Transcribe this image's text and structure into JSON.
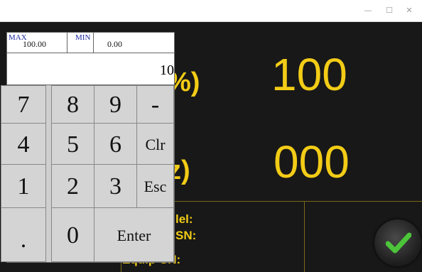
{
  "window": {
    "controls": {
      "minimize": "—",
      "maximize": "☐",
      "close": "✕"
    }
  },
  "display": {
    "unit1": "%)",
    "value1": "100",
    "unit2": "z)",
    "value2": "000"
  },
  "info": {
    "label1": "lel:",
    "label2": "SN:",
    "label3": "Equip-SN:"
  },
  "keypad": {
    "max_label": "MAX",
    "max_value": "100.00",
    "min_label": "MIN",
    "min_value": "0.00",
    "entry_value": "10",
    "keys": {
      "k7": "7",
      "k8": "8",
      "k9": "9",
      "minus": "-",
      "k4": "4",
      "k5": "5",
      "k6": "6",
      "clr": "Clr",
      "k1": "1",
      "k2": "2",
      "k3": "3",
      "esc": "Esc",
      "dot": ".",
      "k0": "0",
      "enter": "Enter"
    }
  },
  "colors": {
    "accent": "#f2cc16",
    "background": "#181818",
    "ok_check": "#4cc53a"
  },
  "icons": {
    "confirm": "checkmark-icon"
  }
}
